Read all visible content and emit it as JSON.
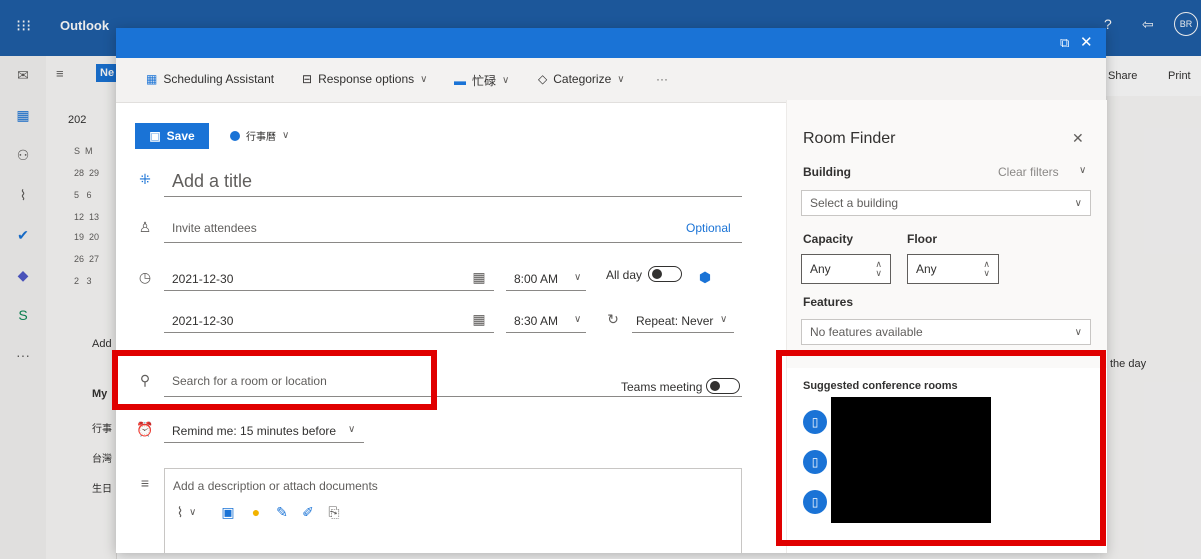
{
  "app": {
    "name": "Outlook",
    "avatar": "BR",
    "share": "Share",
    "print": "Print",
    "the_day": "the day",
    "cal_year": "202",
    "cal_header": "S  M",
    "cal_rows": [
      "28  29",
      "5   6",
      "12  13",
      "19  20",
      "26  27",
      "2   3"
    ],
    "add_label": "Add",
    "my_label": "My",
    "cal_items": [
      "行事",
      "台灣",
      "生日"
    ],
    "new_label": "Ne"
  },
  "toolbar": {
    "scheduling_assistant": "Scheduling Assistant",
    "response_options": "Response options",
    "busy": "忙碌",
    "categorize": "Categorize",
    "more": "···"
  },
  "form": {
    "save": "Save",
    "calendar_name": "行事曆",
    "title_placeholder": "Add a title",
    "invite_placeholder": "Invite attendees",
    "optional": "Optional",
    "start_date": "2021-12-30",
    "start_time": "8:00 AM",
    "all_day": "All day",
    "end_date": "2021-12-30",
    "end_time": "8:30 AM",
    "repeat": "Repeat: Never",
    "location_placeholder": "Search for a room or location",
    "teams_meeting": "Teams meeting",
    "reminder": "Remind me: 15 minutes before",
    "description_placeholder": "Add a description or attach documents"
  },
  "room_finder": {
    "title": "Room Finder",
    "building_label": "Building",
    "clear_filters": "Clear filters",
    "building_placeholder": "Select a building",
    "capacity_label": "Capacity",
    "floor_label": "Floor",
    "capacity_value": "Any",
    "floor_value": "Any",
    "features_label": "Features",
    "features_value": "No features available",
    "suggested_label": "Suggested conference rooms"
  },
  "colors": {
    "accent": "#1a73d6",
    "highlight": "#e00000",
    "topbar": "#1f5fa8"
  }
}
